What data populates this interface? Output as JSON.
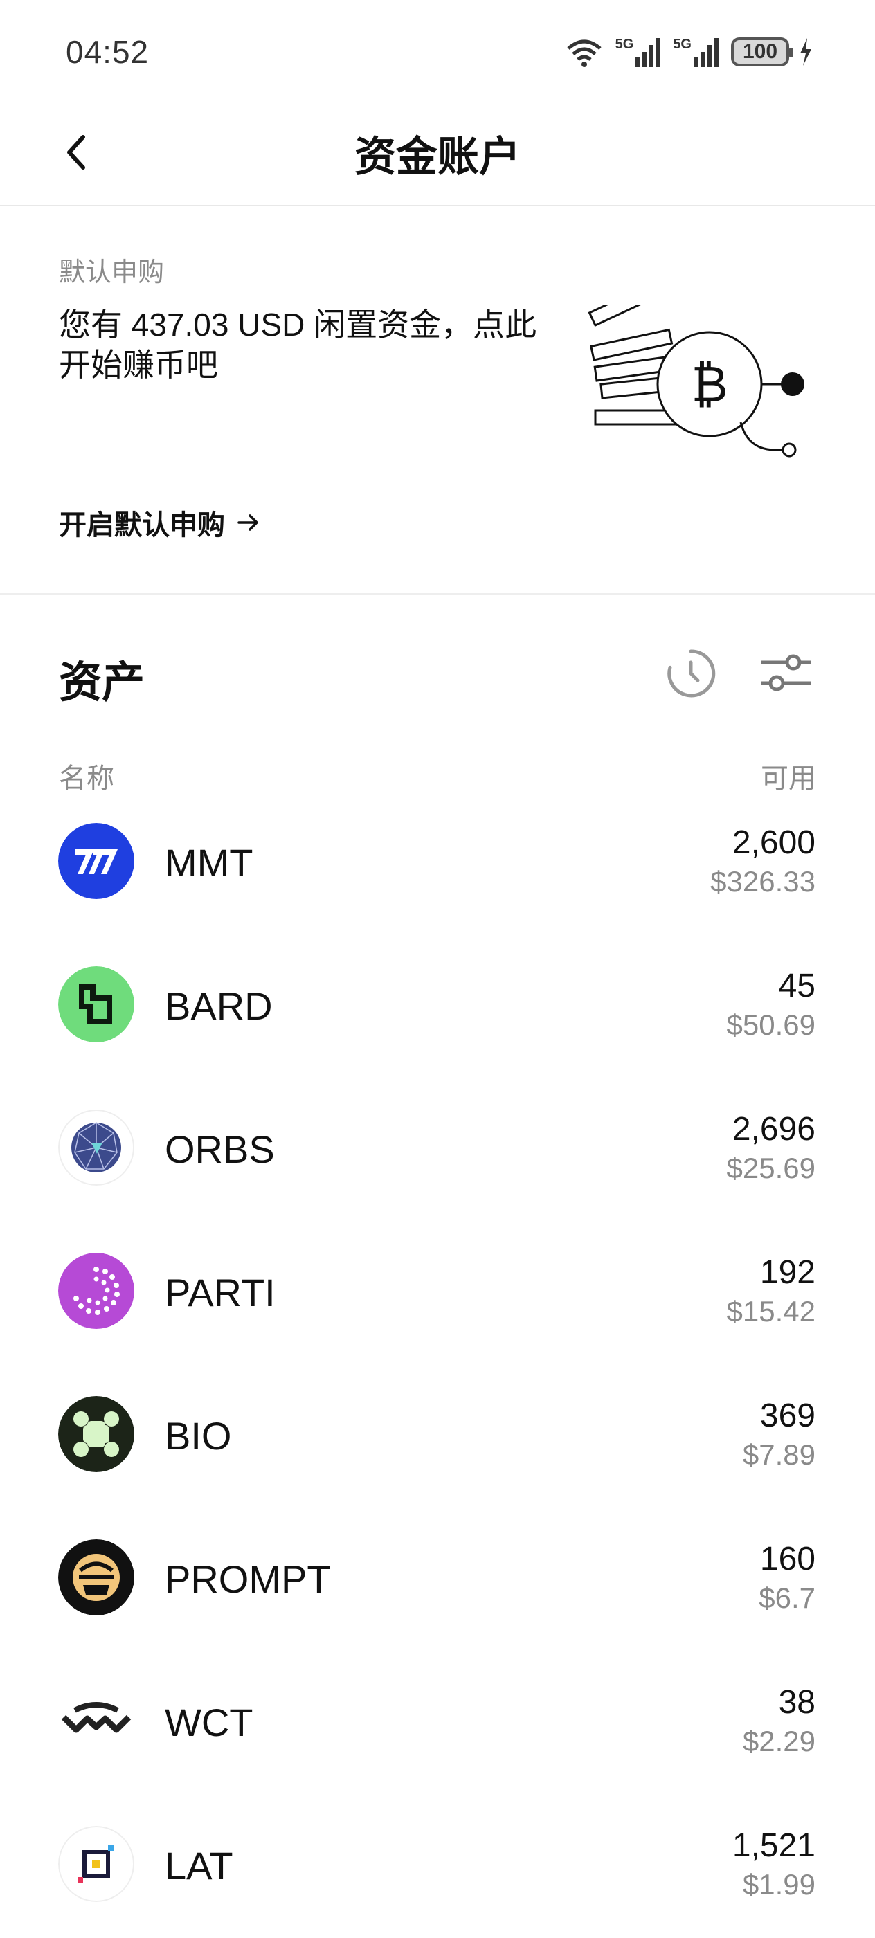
{
  "status_bar": {
    "time": "04:52",
    "battery": "100",
    "network_1": "5G",
    "network_2": "5G"
  },
  "header": {
    "title": "资金账户"
  },
  "promo": {
    "label": "默认申购",
    "text": "您有 437.03 USD 闲置资金，点此开始赚币吧",
    "link": "开启默认申购"
  },
  "assets": {
    "title": "资产",
    "col_name": "名称",
    "col_available": "可用",
    "items": [
      {
        "symbol": "MMT",
        "amount": "2,600",
        "value": "$326.33",
        "icon": "mmt-icon"
      },
      {
        "symbol": "BARD",
        "amount": "45",
        "value": "$50.69",
        "icon": "bard-icon"
      },
      {
        "symbol": "ORBS",
        "amount": "2,696",
        "value": "$25.69",
        "icon": "orbs-icon"
      },
      {
        "symbol": "PARTI",
        "amount": "192",
        "value": "$15.42",
        "icon": "parti-icon"
      },
      {
        "symbol": "BIO",
        "amount": "369",
        "value": "$7.89",
        "icon": "bio-icon"
      },
      {
        "symbol": "PROMPT",
        "amount": "160",
        "value": "$6.7",
        "icon": "prompt-icon"
      },
      {
        "symbol": "WCT",
        "amount": "38",
        "value": "$2.29",
        "icon": "wct-icon"
      },
      {
        "symbol": "LAT",
        "amount": "1,521",
        "value": "$1.99",
        "icon": "lat-icon"
      }
    ]
  },
  "colors": {
    "mmt": "#1f3fe0",
    "bard": "#6fdc7c",
    "parti": "#b64ad6",
    "bio": "#1c2418",
    "prompt": "#111111",
    "text_secondary": "#8a8a8a"
  }
}
